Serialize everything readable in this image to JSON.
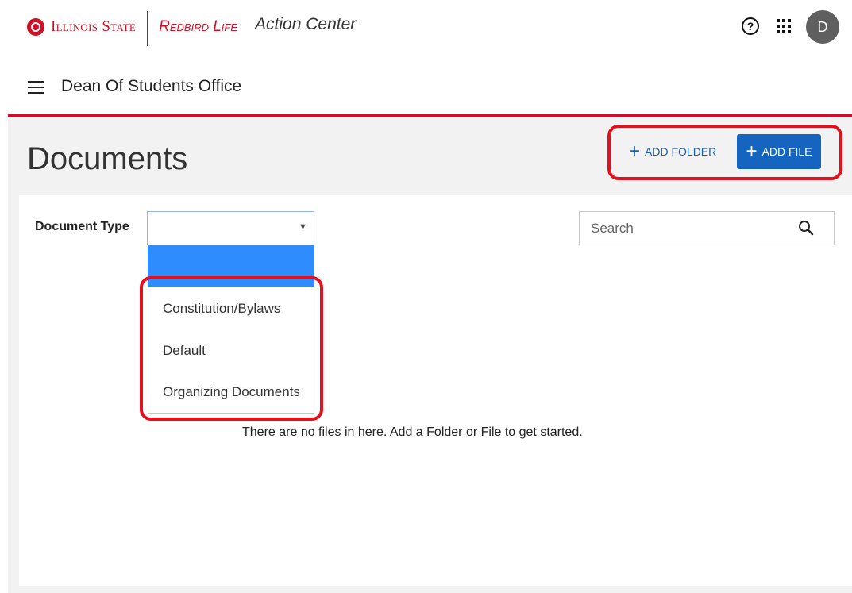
{
  "header": {
    "brand_university": "Illinois State",
    "brand_product": "Redbird Life",
    "app_title": "Action Center",
    "help_glyph": "?",
    "avatar_initial": "D"
  },
  "org": {
    "name": "Dean Of Students Office"
  },
  "page": {
    "title": "Documents",
    "add_folder_label": "ADD FOLDER",
    "add_file_label": "ADD FILE",
    "plus_glyph": "+"
  },
  "filters": {
    "document_type_label": "Document Type",
    "document_type_value": "",
    "dropdown_options": [
      "Constitution/Bylaws",
      "Default",
      "Organizing Documents"
    ]
  },
  "search": {
    "placeholder": "Search"
  },
  "empty_state": {
    "message": "There are no files in here. Add a Folder or File to get started."
  },
  "icons": {
    "menu": "hamburger-icon",
    "help": "help-circle-icon",
    "apps": "apps-grid-icon",
    "search": "search-icon",
    "dropdown": "caret-down-icon"
  },
  "colors": {
    "brand_red": "#ce1126",
    "primary_blue": "#1565c0",
    "link_blue": "#1a5fb4",
    "dropdown_highlight": "#2f8cff",
    "annotation_red": "#e3101e"
  }
}
